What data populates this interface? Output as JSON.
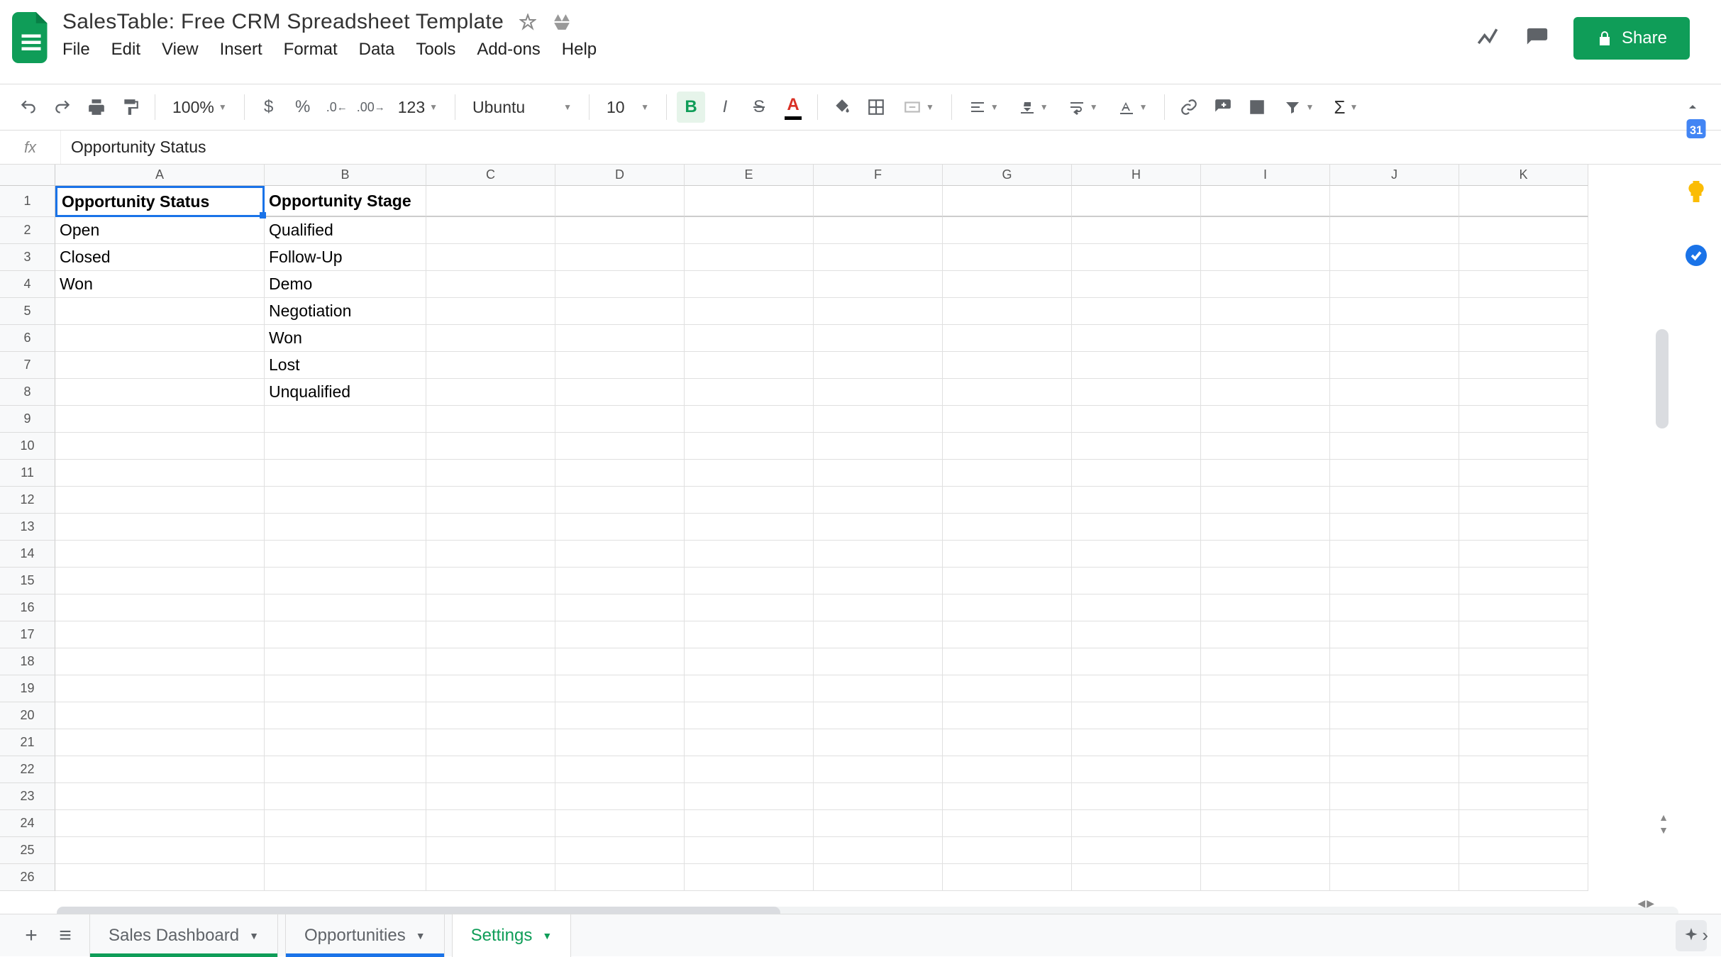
{
  "doc_title": "SalesTable: Free CRM Spreadsheet Template",
  "menus": [
    "File",
    "Edit",
    "View",
    "Insert",
    "Format",
    "Data",
    "Tools",
    "Add-ons",
    "Help"
  ],
  "share_label": "Share",
  "toolbar": {
    "zoom": "100%",
    "font": "Ubuntu",
    "font_size": "10",
    "number_format": "123"
  },
  "formula_bar": {
    "fx_label": "fx",
    "content": "Opportunity Status"
  },
  "columns": [
    "A",
    "B",
    "C",
    "D",
    "E",
    "F",
    "G",
    "H",
    "I",
    "J",
    "K"
  ],
  "row_count": 26,
  "cells": {
    "r1": {
      "A": "Opportunity Status",
      "B": "Opportunity Stage"
    },
    "r2": {
      "A": "Open",
      "B": "Qualified"
    },
    "r3": {
      "A": "Closed",
      "B": "Follow-Up"
    },
    "r4": {
      "A": "Won",
      "B": "Demo"
    },
    "r5": {
      "A": "",
      "B": "Negotiation"
    },
    "r6": {
      "A": "",
      "B": "Won"
    },
    "r7": {
      "A": "",
      "B": "Lost"
    },
    "r8": {
      "A": "",
      "B": "Unqualified"
    }
  },
  "active_cell": "A1",
  "sheet_tabs": [
    {
      "name": "Sales Dashboard",
      "accent": "green"
    },
    {
      "name": "Opportunities",
      "accent": "blue"
    },
    {
      "name": "Settings",
      "accent": "none",
      "active": true
    }
  ]
}
